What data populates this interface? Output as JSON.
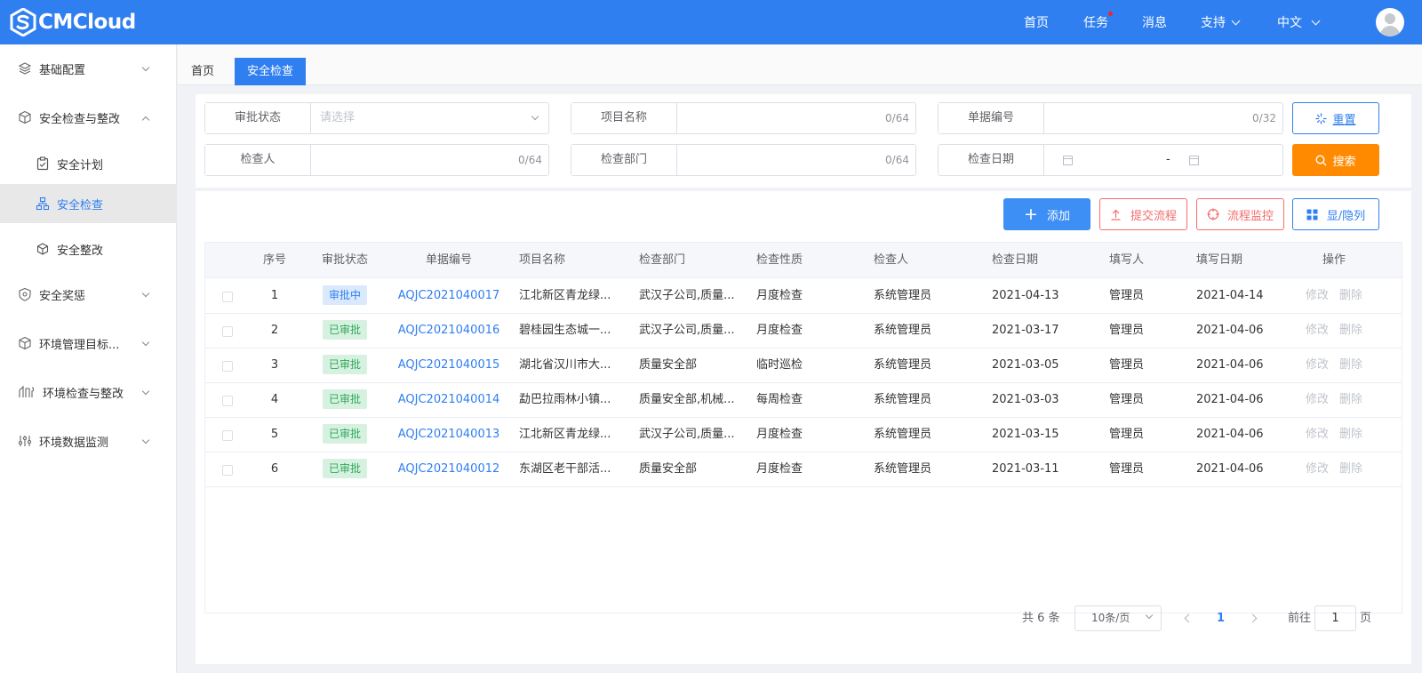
{
  "header": {
    "brand": "CMCloud",
    "nav": {
      "home": "首页",
      "tasks": "任务",
      "messages": "消息",
      "support": "支持",
      "language": "中文"
    }
  },
  "sidebar": {
    "items": [
      {
        "label": "基础配置",
        "icon": "layers-icon"
      },
      {
        "label": "安全检查与整改",
        "icon": "cube-icon"
      },
      {
        "label": "安全计划",
        "icon": "clipboard-icon"
      },
      {
        "label": "安全检查",
        "icon": "sitemap-icon"
      },
      {
        "label": "安全整改",
        "icon": "box-icon"
      },
      {
        "label": "安全奖惩",
        "icon": "shield-icon"
      },
      {
        "label": "环境管理目标...",
        "icon": "cube-icon"
      },
      {
        "label": "环境检查与整改",
        "icon": "tools-icon"
      },
      {
        "label": "环境数据监测",
        "icon": "sliders-icon"
      }
    ]
  },
  "tabs": {
    "home": "首页",
    "active": "安全检查"
  },
  "search": {
    "approval_status": {
      "label": "审批状态",
      "placeholder": "请选择"
    },
    "project_name": {
      "label": "项目名称",
      "count": "0/64"
    },
    "doc_no": {
      "label": "单据编号",
      "count": "0/32"
    },
    "inspector": {
      "label": "检查人",
      "count": "0/64"
    },
    "dept": {
      "label": "检查部门",
      "count": "0/64"
    },
    "date": {
      "label": "检查日期",
      "separator": "-"
    },
    "reset_label": "重置",
    "search_label": "搜索"
  },
  "toolbar": {
    "add": "添加",
    "submit": "提交流程",
    "monitor": "流程监控",
    "columns": "显/隐列"
  },
  "table": {
    "headers": [
      "序号",
      "审批状态",
      "单据编号",
      "项目名称",
      "检查部门",
      "检查性质",
      "检查人",
      "检查日期",
      "填写人",
      "填写日期",
      "操作"
    ],
    "rows": [
      {
        "no": "1",
        "status": "审批中",
        "status_type": "pending",
        "doc": "AQJC2021040017",
        "project": "江北新区青龙绿...",
        "dept": "武汉子公司,质量...",
        "nature": "月度检查",
        "inspector": "系统管理员",
        "date": "2021-04-13",
        "filler": "管理员",
        "fill_date": "2021-04-14",
        "edit": "修改",
        "delete": "删除"
      },
      {
        "no": "2",
        "status": "已审批",
        "status_type": "approved",
        "doc": "AQJC2021040016",
        "project": "碧桂园生态城一...",
        "dept": "武汉子公司,质量...",
        "nature": "月度检查",
        "inspector": "系统管理员",
        "date": "2021-03-17",
        "filler": "管理员",
        "fill_date": "2021-04-06",
        "edit": "修改",
        "delete": "删除"
      },
      {
        "no": "3",
        "status": "已审批",
        "status_type": "approved",
        "doc": "AQJC2021040015",
        "project": "湖北省汉川市大...",
        "dept": "质量安全部",
        "nature": "临时巡检",
        "inspector": "系统管理员",
        "date": "2021-03-05",
        "filler": "管理员",
        "fill_date": "2021-04-06",
        "edit": "修改",
        "delete": "删除"
      },
      {
        "no": "4",
        "status": "已审批",
        "status_type": "approved",
        "doc": "AQJC2021040014",
        "project": "勐巴拉雨林小镇...",
        "dept": "质量安全部,机械...",
        "nature": "每周检查",
        "inspector": "系统管理员",
        "date": "2021-03-03",
        "filler": "管理员",
        "fill_date": "2021-04-06",
        "edit": "修改",
        "delete": "删除"
      },
      {
        "no": "5",
        "status": "已审批",
        "status_type": "approved",
        "doc": "AQJC2021040013",
        "project": "江北新区青龙绿...",
        "dept": "武汉子公司,质量...",
        "nature": "月度检查",
        "inspector": "系统管理员",
        "date": "2021-03-15",
        "filler": "管理员",
        "fill_date": "2021-04-06",
        "edit": "修改",
        "delete": "删除"
      },
      {
        "no": "6",
        "status": "已审批",
        "status_type": "approved",
        "doc": "AQJC2021040012",
        "project": "东湖区老干部活...",
        "dept": "质量安全部",
        "nature": "月度检查",
        "inspector": "系统管理员",
        "date": "2021-03-11",
        "filler": "管理员",
        "fill_date": "2021-04-06",
        "edit": "修改",
        "delete": "删除"
      }
    ]
  },
  "pagination": {
    "total": "共 6 条",
    "page_size": "10条/页",
    "current": "1",
    "goto_prefix": "前往",
    "goto_value": "1",
    "goto_suffix": "页"
  },
  "colors": {
    "primary": "#2f7ff0",
    "orange": "#ff8a00",
    "danger": "#f56c6c",
    "success": "#31a85b"
  }
}
